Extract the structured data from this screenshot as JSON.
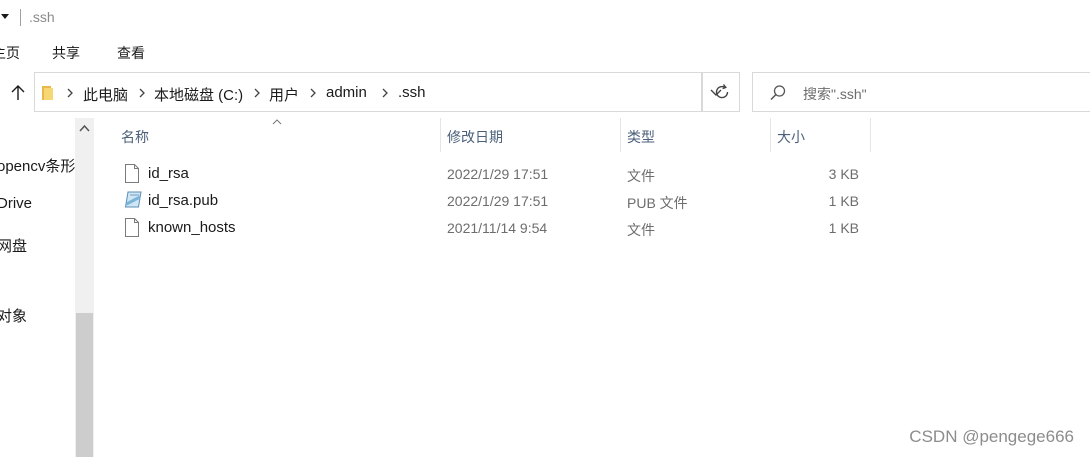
{
  "window": {
    "title": ".ssh"
  },
  "ribbon": {
    "tabs": [
      {
        "label": "主页"
      },
      {
        "label": "共享"
      },
      {
        "label": "查看"
      }
    ]
  },
  "address": {
    "breadcrumbs": [
      "此电脑",
      "本地磁盘 (C:)",
      "用户",
      "admin",
      ".ssh"
    ]
  },
  "search": {
    "placeholder": "搜索\".ssh\""
  },
  "nav": {
    "items": [
      {
        "label": "opencv条形"
      },
      {
        "label": "Drive"
      },
      {
        "label": "网盘"
      },
      {
        "label": "对象"
      }
    ]
  },
  "columns": {
    "name": "名称",
    "modified": "修改日期",
    "type": "类型",
    "size": "大小"
  },
  "files": [
    {
      "name": "id_rsa",
      "modified": "2022/1/29 17:51",
      "type": "文件",
      "size": "3 KB",
      "icon": "blank-file-icon"
    },
    {
      "name": "id_rsa.pub",
      "modified": "2022/1/29 17:51",
      "type": "PUB 文件",
      "size": "1 KB",
      "icon": "pub-file-icon"
    },
    {
      "name": "known_hosts",
      "modified": "2021/11/14 9:54",
      "type": "文件",
      "size": "1 KB",
      "icon": "blank-file-icon"
    }
  ],
  "watermark": "CSDN @pengege666"
}
